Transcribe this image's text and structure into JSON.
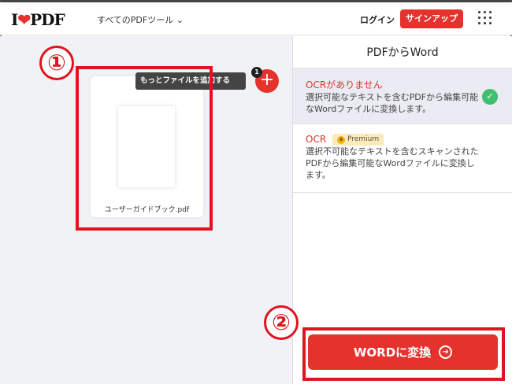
{
  "header": {
    "logo": "I❤PDF",
    "tools_menu": "すべてのPDFツール",
    "login": "ログイン",
    "signup": "サインアップ"
  },
  "left": {
    "tooltip": "もっとファイルを追加する",
    "file_count": "1",
    "file_name": "ユーザーガイドブック.pdf"
  },
  "right": {
    "title": "PDFからWord",
    "options": [
      {
        "title": "OCRがありません",
        "description": "選択可能なテキストを含むPDFから編集可能なWordファイルに変換します。",
        "selected": true
      },
      {
        "title": "OCR",
        "badge": "Premium",
        "description": "選択不可能なテキストを含むスキャンされたPDFから編集可能なWordファイルに変換します。",
        "selected": false
      }
    ],
    "convert_button": "WORDに変換"
  },
  "annotations": {
    "step1": "①",
    "step2": "②",
    "color": "#e0141e"
  },
  "colors": {
    "accent": "#e5322d",
    "check": "#3fbf6f"
  }
}
